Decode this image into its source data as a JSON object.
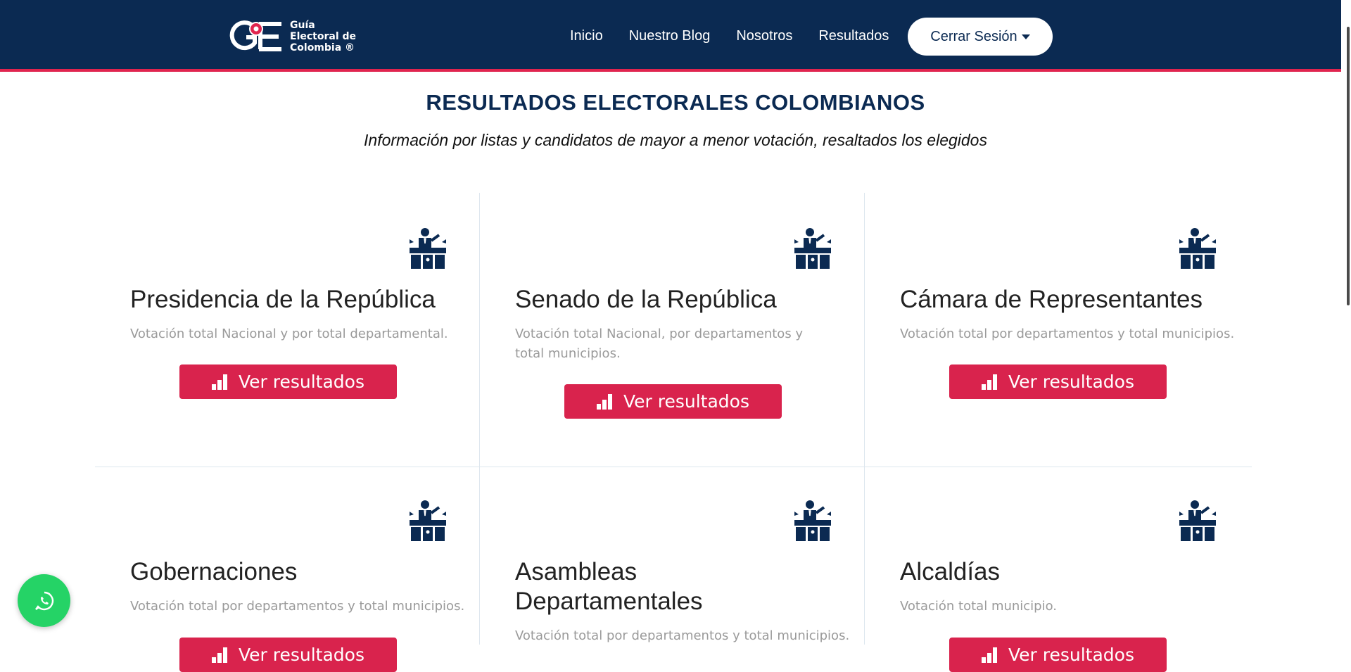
{
  "colors": {
    "navy": "#0b2a52",
    "accent": "#e0244e",
    "button": "#d9234d",
    "whatsapp": "#25d366"
  },
  "brand": {
    "line1": "Guía",
    "line2": "Electoral de",
    "line3": "Colombia ®"
  },
  "nav": {
    "items": [
      {
        "label": "Inicio"
      },
      {
        "label": "Nuestro Blog"
      },
      {
        "label": "Nosotros"
      },
      {
        "label": "Resultados"
      }
    ],
    "session_label": "Cerrar Sesión"
  },
  "header": {
    "title": "RESULTADOS ELECTORALES COLOMBIANOS",
    "subtitle": "Información por listas y candidatos de mayor a menor votación, resaltados los elegidos"
  },
  "cards": [
    {
      "title": "Presidencia de la República",
      "description": "Votación total Nacional y por total departamental.",
      "button": "Ver resultados",
      "icon": "podium-speaker-icon"
    },
    {
      "title": "Senado de la República",
      "description": "Votación total Nacional, por departamentos y total municipios.",
      "button": "Ver resultados",
      "icon": "podium-speaker-icon"
    },
    {
      "title": "Cámara de Representantes",
      "description": "Votación total por departamentos y total municipios.",
      "button": "Ver resultados",
      "icon": "podium-speaker-icon"
    },
    {
      "title": "Gobernaciones",
      "description": "Votación total por departamentos y total municipios.",
      "button": "Ver resultados",
      "icon": "podium-speaker-icon"
    },
    {
      "title": "Asambleas Departamentales",
      "description": "Votación total por departamentos y total municipios.",
      "button": "Ver resultados",
      "icon": "podium-speaker-icon"
    },
    {
      "title": "Alcaldías",
      "description": "Votación total municipio.",
      "button": "Ver resultados",
      "icon": "podium-speaker-icon"
    }
  ],
  "floating": {
    "icon": "whatsapp-icon"
  }
}
